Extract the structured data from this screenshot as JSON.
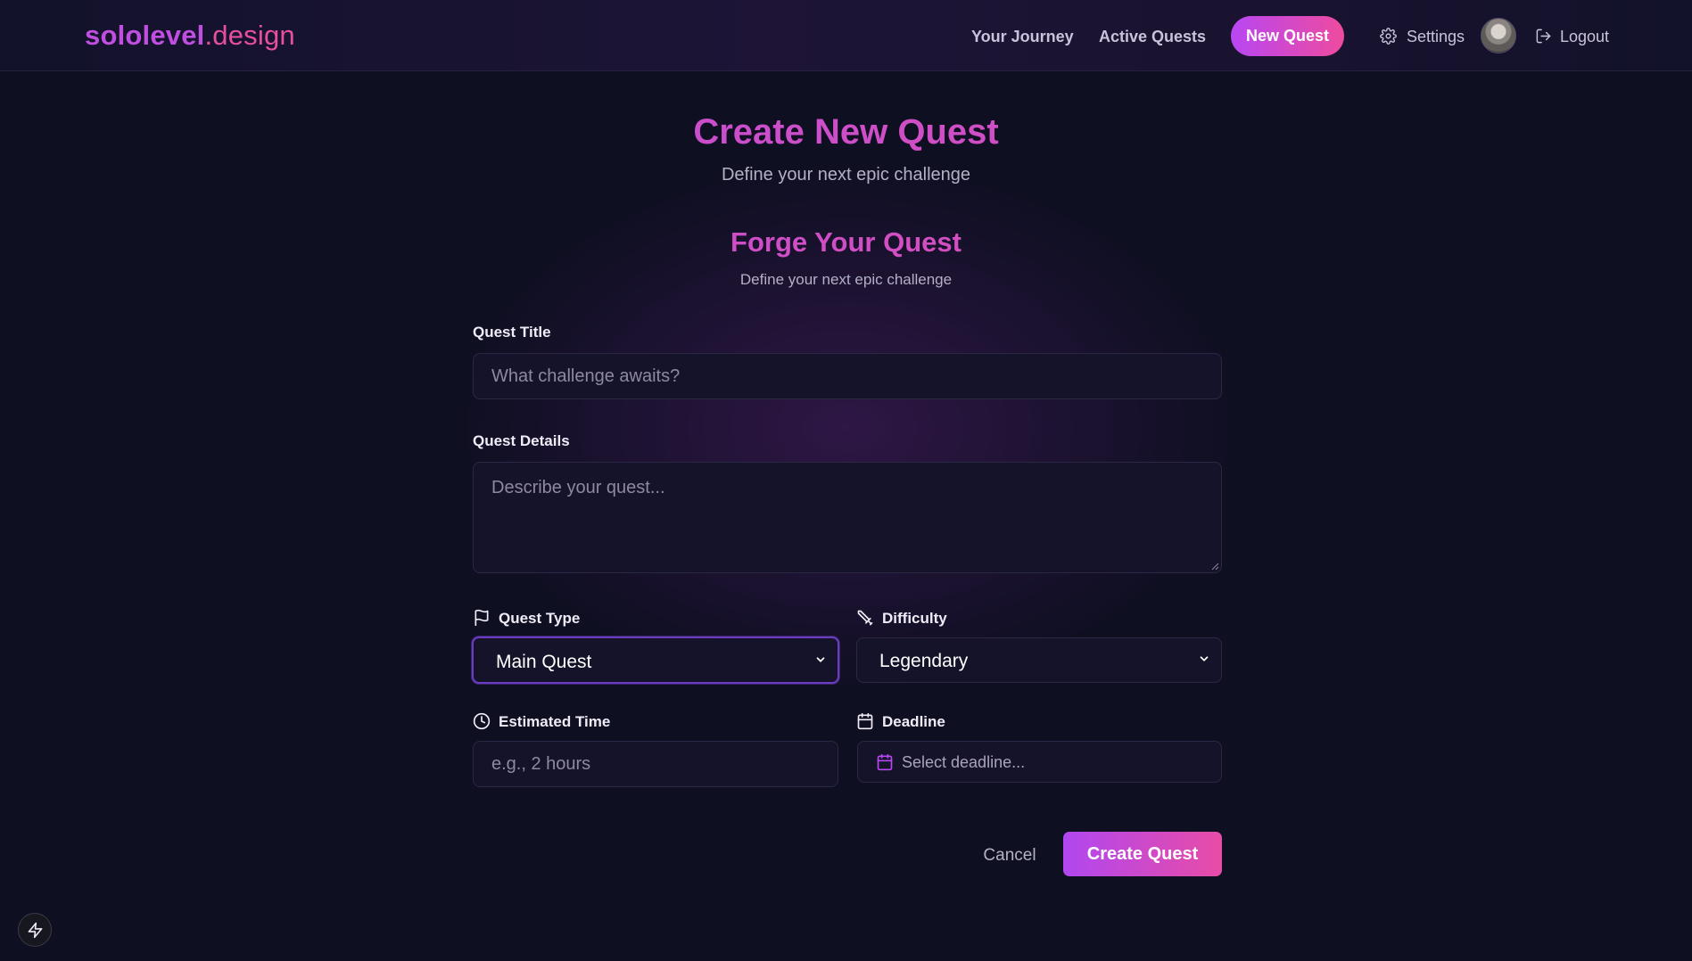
{
  "brand": {
    "bold": "sololevel",
    "light": ".design"
  },
  "nav": {
    "journey": "Your Journey",
    "active_quests": "Active Quests",
    "new_quest": "New Quest",
    "settings": "Settings",
    "logout": "Logout"
  },
  "page": {
    "title": "Create New Quest",
    "subtitle": "Define your next epic challenge",
    "form_title": "Forge Your Quest",
    "form_subtitle": "Define your next epic challenge"
  },
  "form": {
    "title_label": "Quest Title",
    "title_placeholder": "What challenge awaits?",
    "details_label": "Quest Details",
    "details_placeholder": "Describe your quest...",
    "type_label": "Quest Type",
    "type_value": "Main Quest",
    "difficulty_label": "Difficulty",
    "difficulty_value": "Legendary",
    "time_label": "Estimated Time",
    "time_placeholder": "e.g., 2 hours",
    "deadline_label": "Deadline",
    "deadline_placeholder": "Select deadline...",
    "cancel": "Cancel",
    "submit": "Create Quest"
  },
  "icons": {
    "settings": "gear-icon",
    "logout": "logout-icon",
    "quest_type": "flag-icon",
    "difficulty": "sword-icon",
    "time": "clock-icon",
    "deadline": "calendar-icon",
    "dev_tools": "lightning-icon"
  },
  "colors": {
    "background": "#0f0f22",
    "accent_purple": "#b847f2",
    "accent_pink": "#ee4b9e",
    "input_bg": "#15132a",
    "focus_border": "#6c3cbf"
  }
}
